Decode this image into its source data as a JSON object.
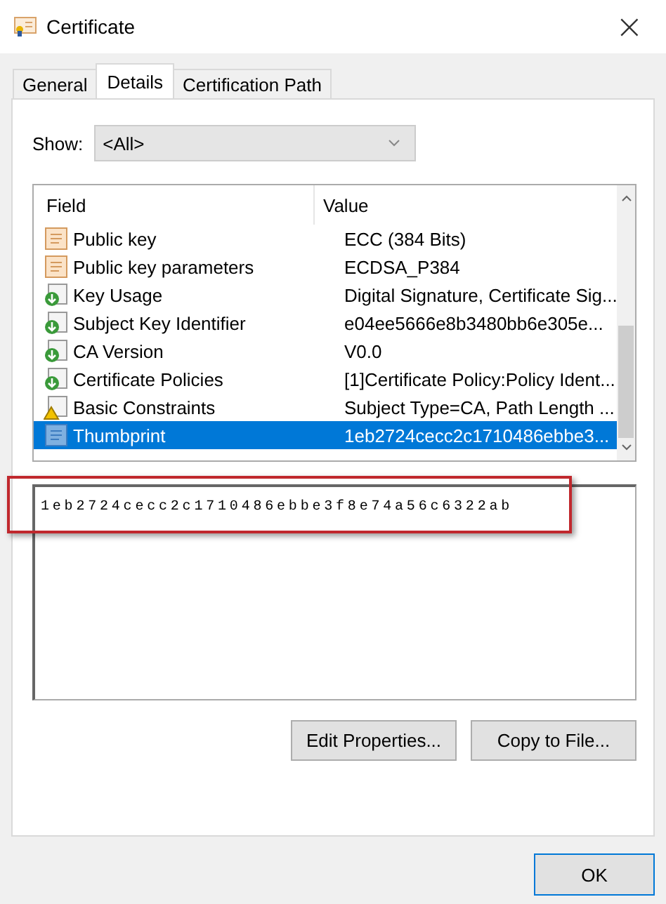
{
  "window": {
    "title": "Certificate",
    "close": "×"
  },
  "tabs": [
    {
      "label": "General",
      "selected": false
    },
    {
      "label": "Details",
      "selected": true
    },
    {
      "label": "Certification Path",
      "selected": false
    }
  ],
  "show": {
    "label": "Show:",
    "value": "<All>"
  },
  "table": {
    "columns": [
      "Field",
      "Value"
    ],
    "rows": [
      {
        "kind": "property",
        "field": "Public key",
        "value": "ECC (384 Bits)",
        "selected": false
      },
      {
        "kind": "property",
        "field": "Public key parameters",
        "value": "ECDSA_P384",
        "selected": false
      },
      {
        "kind": "extension",
        "field": "Key Usage",
        "value": "Digital Signature, Certificate Sig...",
        "selected": false
      },
      {
        "kind": "extension",
        "field": "Subject Key Identifier",
        "value": "e04ee5666e8b3480bb6e305e...",
        "selected": false
      },
      {
        "kind": "extension",
        "field": "CA Version",
        "value": "V0.0",
        "selected": false
      },
      {
        "kind": "extension",
        "field": "Certificate Policies",
        "value": "[1]Certificate Policy:Policy Ident...",
        "selected": false
      },
      {
        "kind": "critical",
        "field": "Basic Constraints",
        "value": "Subject Type=CA, Path Length ...",
        "selected": false
      },
      {
        "kind": "property",
        "field": "Thumbprint",
        "value": "1eb2724cecc2c1710486ebbe3...",
        "selected": true
      }
    ]
  },
  "detail_value": "1eb2724cecc2c1710486ebbe3f8e74a56c6322ab",
  "buttons": [
    "Edit Properties...",
    "Copy to File..."
  ],
  "footer_buttons": [
    "OK"
  ]
}
